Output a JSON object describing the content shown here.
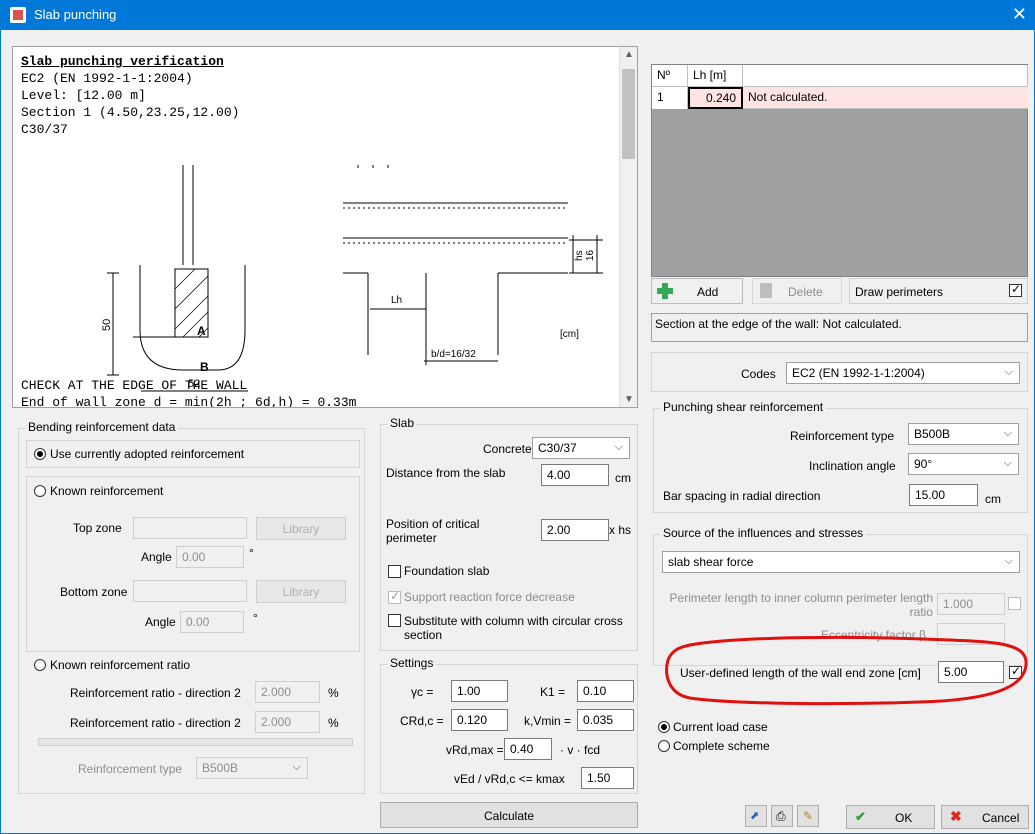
{
  "window": {
    "title": "Slab punching",
    "close": "✕"
  },
  "report": {
    "heading": "Slab punching verification",
    "lines": [
      "EC2 (EN 1992-1-1:2004)",
      "Level: [12.00 m]",
      "Section 1 (4.50,23.25,12.00)",
      "C30/37"
    ],
    "bottom1": "CHECK AT THE EDGE OF THE WALL",
    "bottom2": "End of wall zone d = min(2h ; 6d,h) = 0.33m",
    "fig": {
      "dim50": "50",
      "lblA": "A",
      "lblB": "B",
      "dim52": "52",
      "lh": "Lh",
      "hs": "hs",
      "d16": "16",
      "bd": "b/d=16/32",
      "unit": "[cm]"
    }
  },
  "bending": {
    "title": "Bending reinforcement data",
    "use_current": "Use currently adopted reinforcement",
    "known": "Known reinforcement",
    "top_zone": "Top zone",
    "bottom_zone": "Bottom zone",
    "library": "Library",
    "angle": "Angle",
    "angle_top": "0.00",
    "angle_bottom": "0.00",
    "deg": "°",
    "known_ratio": "Known reinforcement ratio",
    "ratio_label1": "Reinforcement ratio - direction 2",
    "ratio_label2": "Reinforcement ratio - direction 2",
    "ratio1": "2.000",
    "ratio2": "2.000",
    "pct": "%",
    "reinf_type": "Reinforcement type",
    "reinf_value": "B500B"
  },
  "slab": {
    "title": "Slab",
    "concrete": "Concrete",
    "concrete_value": "C30/37",
    "distance": "Distance from the slab",
    "distance_value": "4.00",
    "cm": "cm",
    "position": "Position of critical perimeter",
    "position_value": "2.00",
    "xhs": "x hs",
    "foundation": "Foundation slab",
    "support": "Support reaction force decrease",
    "substitute": "Substitute with column with circular cross section"
  },
  "settings": {
    "title": "Settings",
    "gc": "γc =",
    "gc_v": "1.00",
    "k1": "K1 =",
    "k1_v": "0.10",
    "crd": "CRd,c =",
    "crd_v": "0.120",
    "kvmin": "k,Vmin =",
    "kvmin_v": "0.035",
    "vrd": "vRd,max =",
    "vrd_v": "0.40",
    "vrd_s": "· v · fcd",
    "ved": "vEd / vRd,c <= kmax",
    "ved_v": "1.50"
  },
  "calculate": "Calculate",
  "grid": {
    "h_no": "Nº",
    "h_lh": "Lh [m]",
    "r_no": "1",
    "r_lh": "0.240",
    "r_status": "Not calculated."
  },
  "toolbar": {
    "add": "Add",
    "delete": "Delete",
    "draw": "Draw perimeters"
  },
  "status": "Section at the edge of the wall: Not calculated.",
  "codes": {
    "label": "Codes",
    "value": "EC2 (EN 1992-1-1:2004)"
  },
  "punching": {
    "title": "Punching shear reinforcement",
    "reinf_type": "Reinforcement type",
    "reinf_value": "B500B",
    "incl": "Inclination angle",
    "incl_value": "90°",
    "spacing": "Bar spacing in radial direction",
    "spacing_value": "15.00",
    "cm": "cm"
  },
  "source": {
    "title": "Source of the influences and stresses",
    "value": "slab shear force",
    "perimeter": "Perimeter length to inner column perimeter length ratio",
    "perimeter_value": "1.000",
    "eccentric": "Eccentricity factor β",
    "userdef": "User-defined length of the wall end zone [cm]",
    "userdef_value": "5.00"
  },
  "load": {
    "current": "Current load case",
    "complete": "Complete scheme"
  },
  "footer": {
    "ok": "OK",
    "cancel": "Cancel"
  },
  "colors": {
    "title": "#0078d7",
    "highlight": "#e01010",
    "row": "#ffe4e4"
  }
}
